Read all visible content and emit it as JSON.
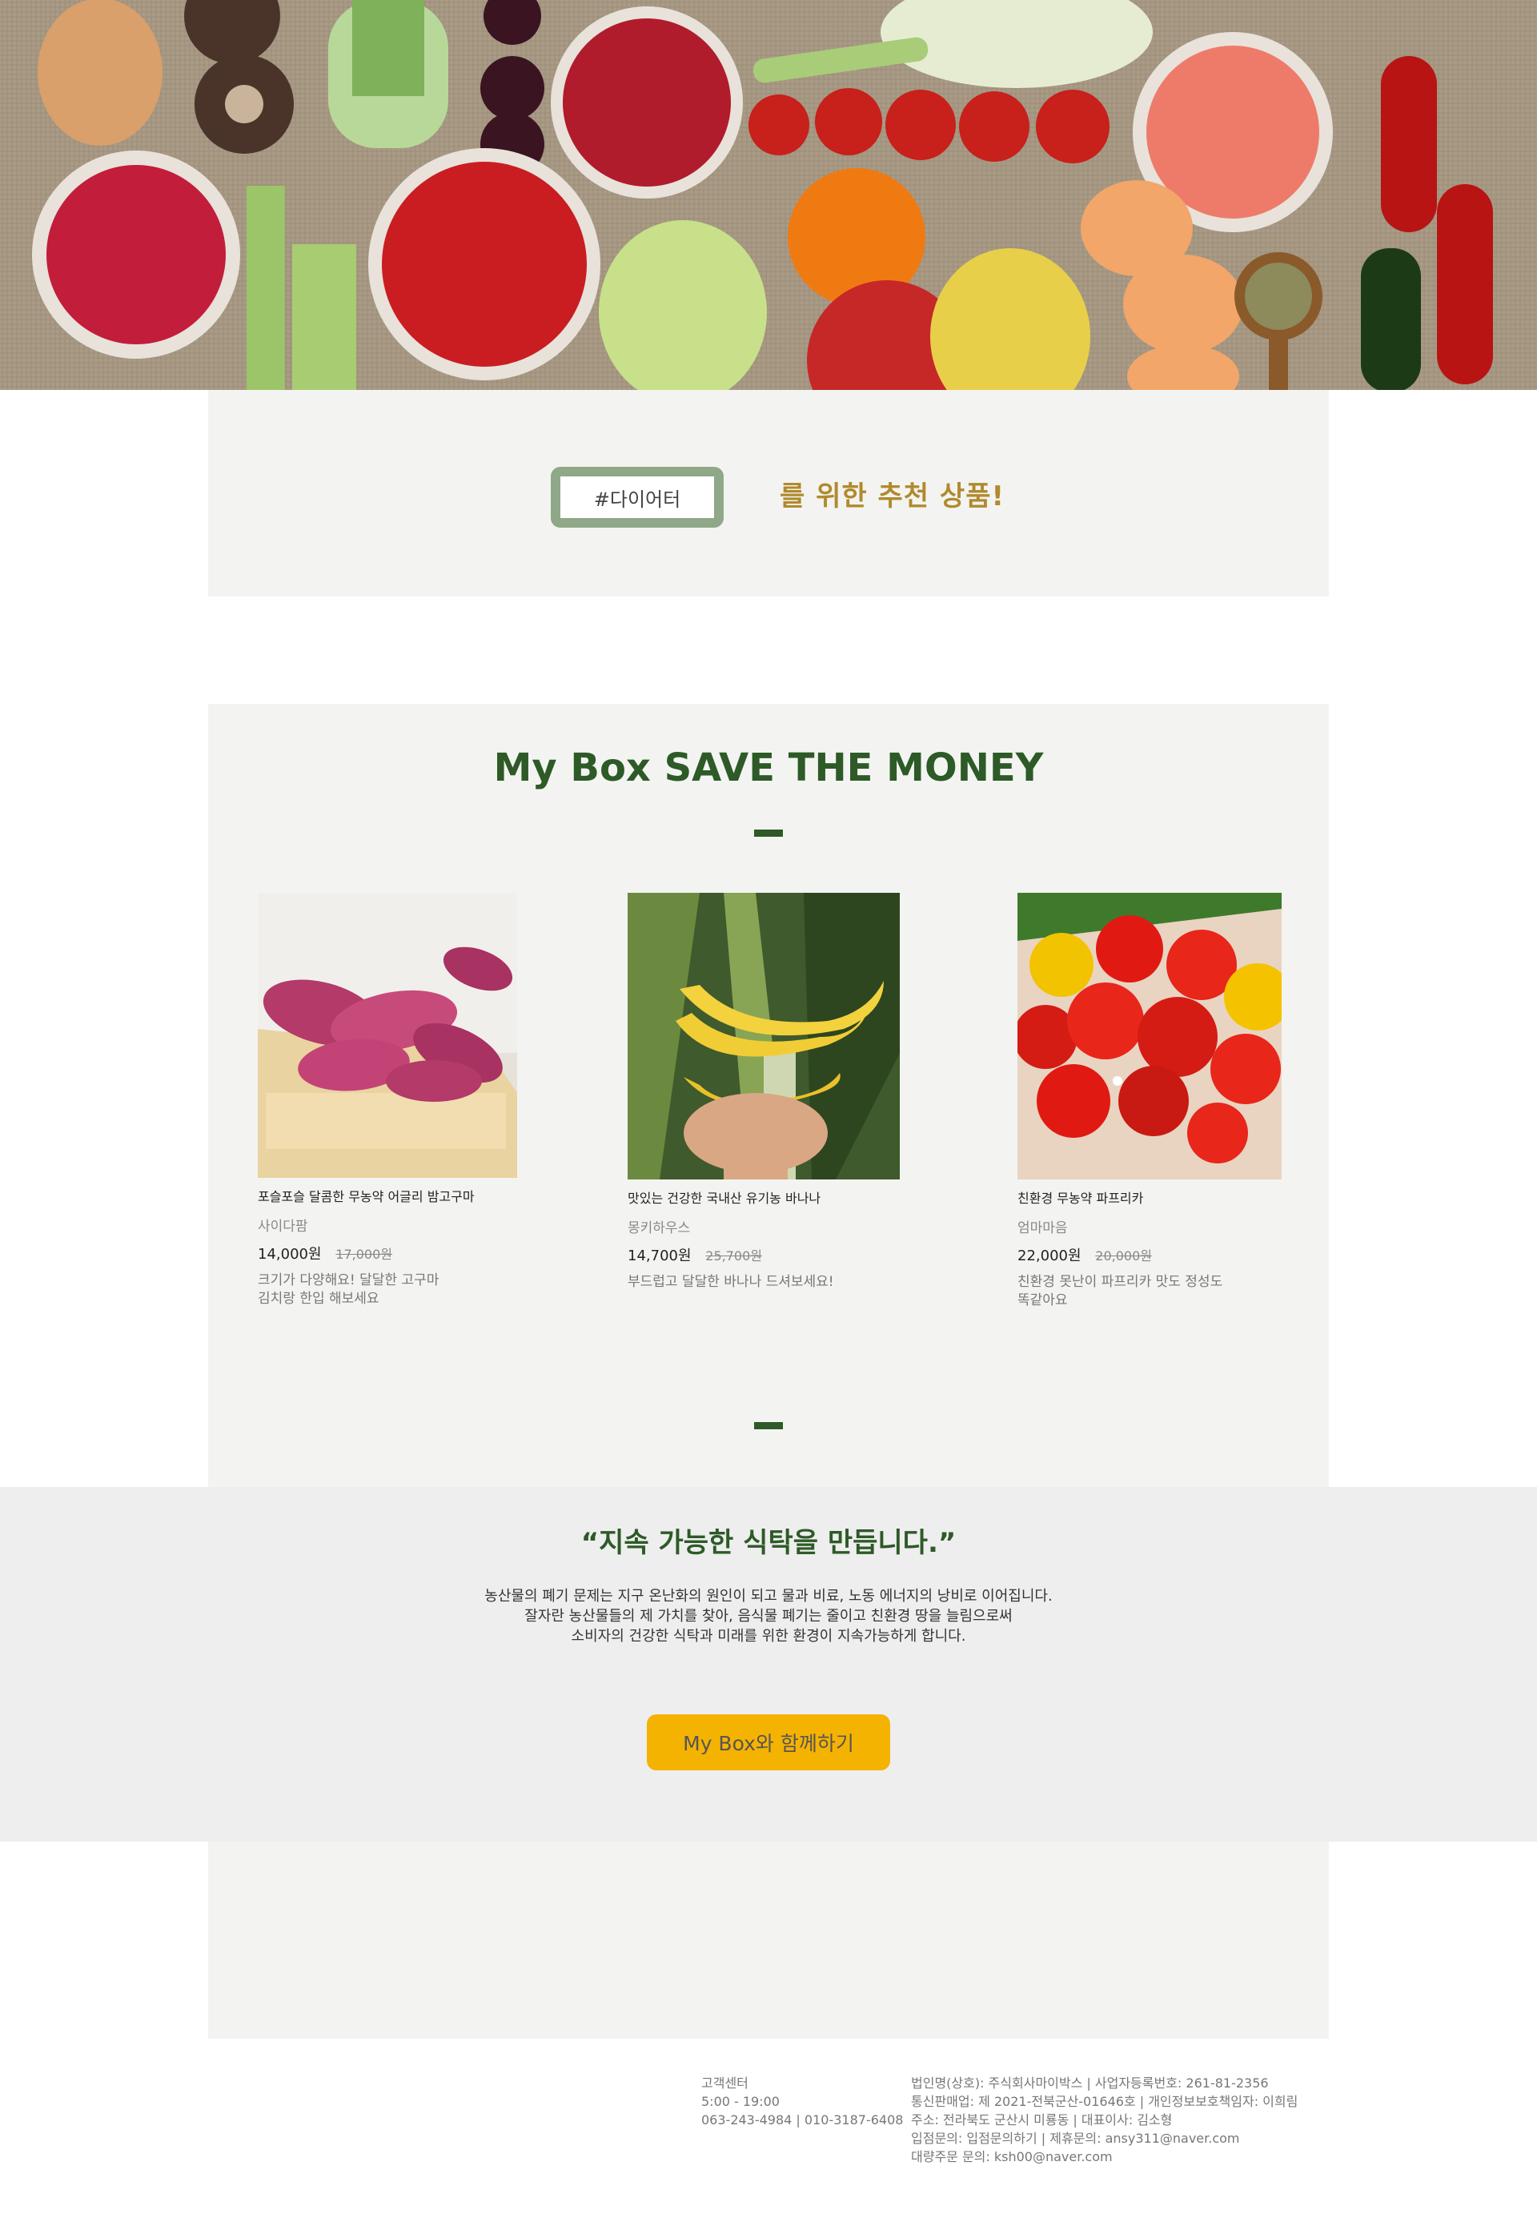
{
  "promo": {
    "tag": "#다이어터",
    "text": "를 위한 추천 상품!"
  },
  "products_section": {
    "title": "My Box SAVE THE MONEY",
    "items": [
      {
        "name": "포슬포슬 달콤한 무농약 어글리 밤고구마",
        "seller": "사이다팜",
        "price": "14,000원",
        "original_price": "17,000원",
        "desc_line1": "크기가 다양해요! 달달한 고구마",
        "desc_line2": "김치랑 한입 해보세요",
        "image": "sweet-potato-crate-photo"
      },
      {
        "name": "맛있는 건강한 국내산 유기농 바나나",
        "seller": "몽키하우스",
        "price": "14,700원",
        "original_price": "25,700원",
        "desc_line1": "부드럽고 달달한 바나나 드셔보세요!",
        "desc_line2": "",
        "image": "banana-hand-photo"
      },
      {
        "name": "친환경 무농약 파프리카",
        "seller": "엄마마음",
        "price": "22,000원",
        "original_price": "20,000원",
        "desc_line1": "친환경 못난이 파프리카 맛도 정성도",
        "desc_line2": "똑같아요",
        "image": "paprika-photo"
      }
    ]
  },
  "mission": {
    "title": "“지속 가능한 식탁을 만듭니다.”",
    "line1": "농산물의 폐기 문제는 지구 온난화의 원인이 되고 물과 비료, 노동 에너지의 낭비로 이어집니다.",
    "line2": "잘자란 농산물들의 제 가치를 찾아, 음식물 폐기는 줄이고 친환경 땅을 늘림으로써",
    "line3": "소비자의 건강한 식탁과 미래를 위한 환경이 지속가능하게 합니다.",
    "cta": "My Box와 함께하기"
  },
  "footer": {
    "cs_title": "고객센터",
    "cs_hours": "5:00 - 19:00",
    "cs_phone": "063-243-4984 | 010-3187-6408",
    "company": "법인명(상호): 주식회사마이박스 | 사업자등록번호: 261-81-2356",
    "license": "통신판매업: 제 2021-전북군산-01646호 | 개인정보보호책임자: 이희림",
    "address": "주소: 전라북도 군산시 미룡동 | 대표이사: 김소형",
    "inquiry": "입점문의: 입점문의하기 | 제휴문의: ansy311@naver.com",
    "bulk": "대량주문 문의: ksh00@naver.com"
  },
  "colors": {
    "brand_green": "#2d5a27",
    "tag_border": "#8fa888",
    "promo_gold": "#b08a2e",
    "cta_yellow": "#f5b301",
    "section_bg": "#f3f4f1"
  }
}
